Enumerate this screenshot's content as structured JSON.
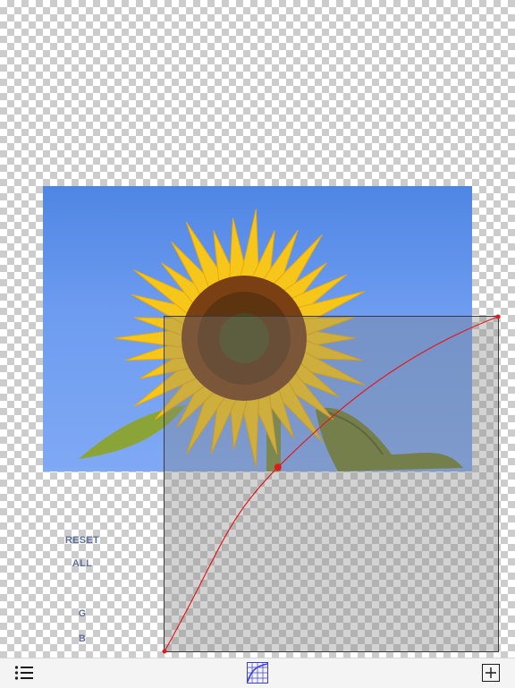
{
  "side_panel": {
    "reset_label": "RESET",
    "all_label": "ALL",
    "g_label": "G",
    "b_label": "B"
  },
  "curve": {
    "color": "#e01b1b",
    "control_points": [
      [
        0,
        0
      ],
      [
        0.34,
        0.55
      ],
      [
        1,
        1
      ]
    ]
  },
  "toolbar": {
    "left_icon": "list-icon",
    "center_icon": "grid-curve-icon",
    "right_icon": "add-icon"
  },
  "colors": {
    "sky": "#6e9cf0",
    "petal": "#f7c61a",
    "disk": "#6b3a16",
    "accent_text": "#5a6e9c"
  }
}
